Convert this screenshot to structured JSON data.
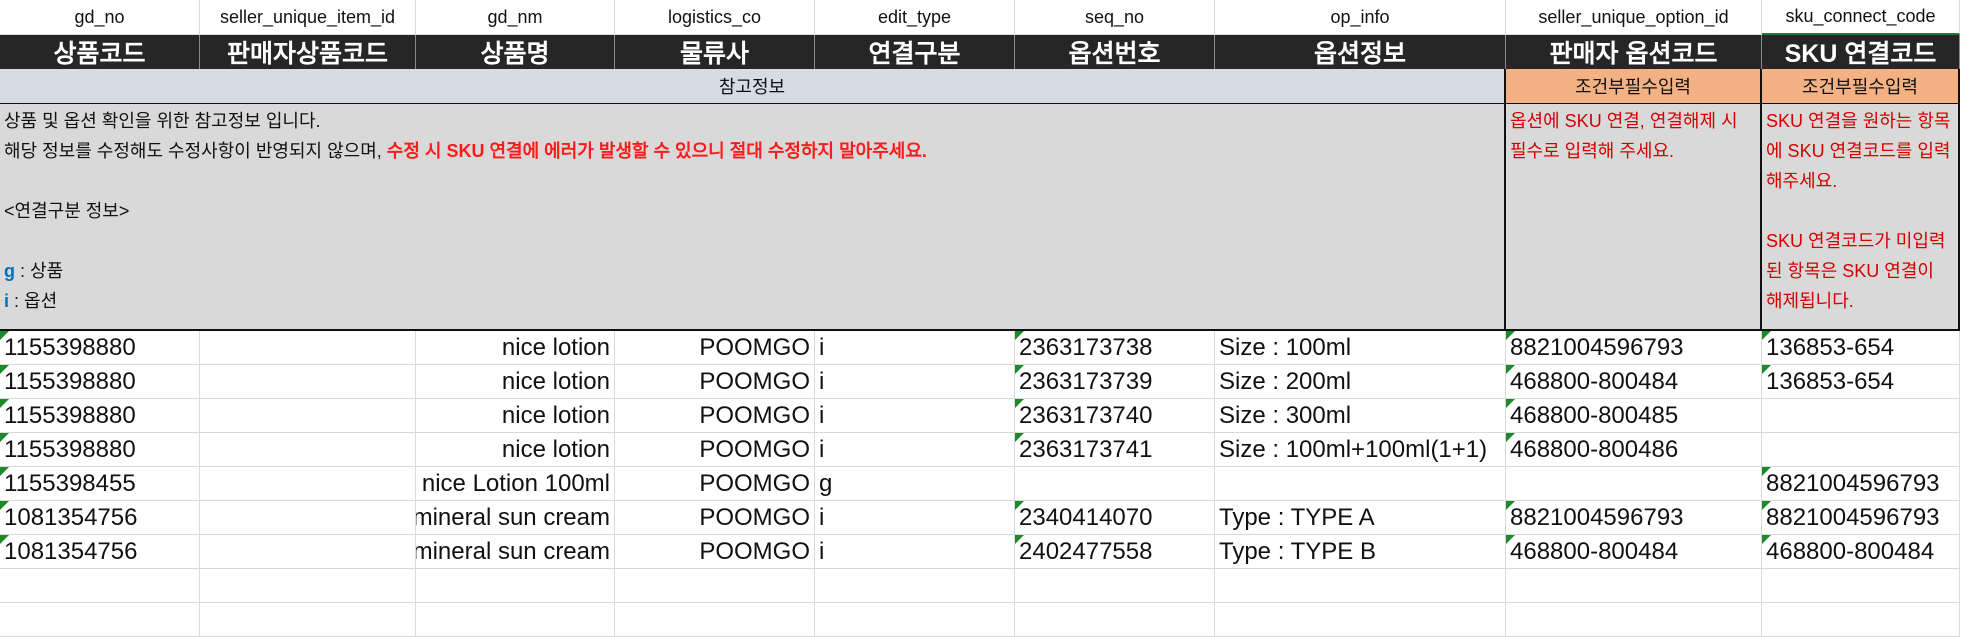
{
  "columns": [
    {
      "key": "gd_no",
      "title": "상품코드"
    },
    {
      "key": "seller_unique_item_id",
      "title": "판매자상품코드"
    },
    {
      "key": "gd_nm",
      "title": "상품명"
    },
    {
      "key": "logistics_co",
      "title": "물류사"
    },
    {
      "key": "edit_type",
      "title": "연결구분"
    },
    {
      "key": "seq_no",
      "title": "옵션번호"
    },
    {
      "key": "op_info",
      "title": "옵션정보"
    },
    {
      "key": "seller_unique_option_id",
      "title": "판매자 옵션코드"
    },
    {
      "key": "sku_connect_code",
      "title": "SKU 연결코드"
    }
  ],
  "band": {
    "reference": "참고정보",
    "conditional_required_1": "조건부필수입력",
    "conditional_required_2": "조건부필수입력"
  },
  "notes": {
    "reference_line1": "상품 및 옵션 확인을 위한 참고정보 입니다.",
    "reference_line2_a": "해당 정보를 수정해도 수정사항이 반영되지 않으며, ",
    "reference_line2_b": "수정 시 SKU 연결에 에러가 발생할 수 있으니 절대 수정하지 말아주세요.",
    "edit_type_heading": "<연결구분 정보>",
    "g_key": "g",
    "g_desc": " : 상품",
    "i_key": "i",
    "i_desc": " : 옵션",
    "option_code_note": "옵션에 SKU 연결, 연결해제 시 필수로 입력해 주세요.",
    "sku_note_1": "SKU 연결을 원하는 항목에 SKU 연결코드를 입력해주세요.",
    "sku_note_2": "SKU 연결코드가 미입력된 항목은 SKU 연결이 해제됩니다."
  },
  "rows": [
    [
      "1155398880",
      "",
      "nice lotion",
      "POOMGO",
      "i",
      "2363173738",
      "Size : 100ml",
      "8821004596793",
      "136853-654"
    ],
    [
      "1155398880",
      "",
      "nice lotion",
      "POOMGO",
      "i",
      "2363173739",
      "Size : 200ml",
      "468800-800484",
      "136853-654"
    ],
    [
      "1155398880",
      "",
      "nice lotion",
      "POOMGO",
      "i",
      "2363173740",
      "Size : 300ml",
      "468800-800485",
      ""
    ],
    [
      "1155398880",
      "",
      "nice lotion",
      "POOMGO",
      "i",
      "2363173741",
      "Size : 100ml+100ml(1+1)",
      "468800-800486",
      ""
    ],
    [
      "1155398455",
      "",
      "nice Lotion 100ml",
      "POOMGO",
      "g",
      "",
      "",
      "",
      "8821004596793"
    ],
    [
      "1081354756",
      "",
      "mineral sun cream",
      "POOMGO",
      "i",
      "2340414070",
      "Type : TYPE A",
      "8821004596793",
      "8821004596793"
    ],
    [
      "1081354756",
      "",
      "mineral sun cream",
      "POOMGO",
      "i",
      "2402477558",
      "Type : TYPE B",
      "468800-800484",
      "468800-800484"
    ]
  ],
  "colors": {
    "title_bg": "#262626",
    "reference_band": "#d6dce4",
    "required_band": "#f4b183",
    "note_bg": "#d9d9d9",
    "warning_red": "#ff1b1b",
    "key_blue": "#0070c0",
    "error_flag": "#1d8a2a"
  }
}
